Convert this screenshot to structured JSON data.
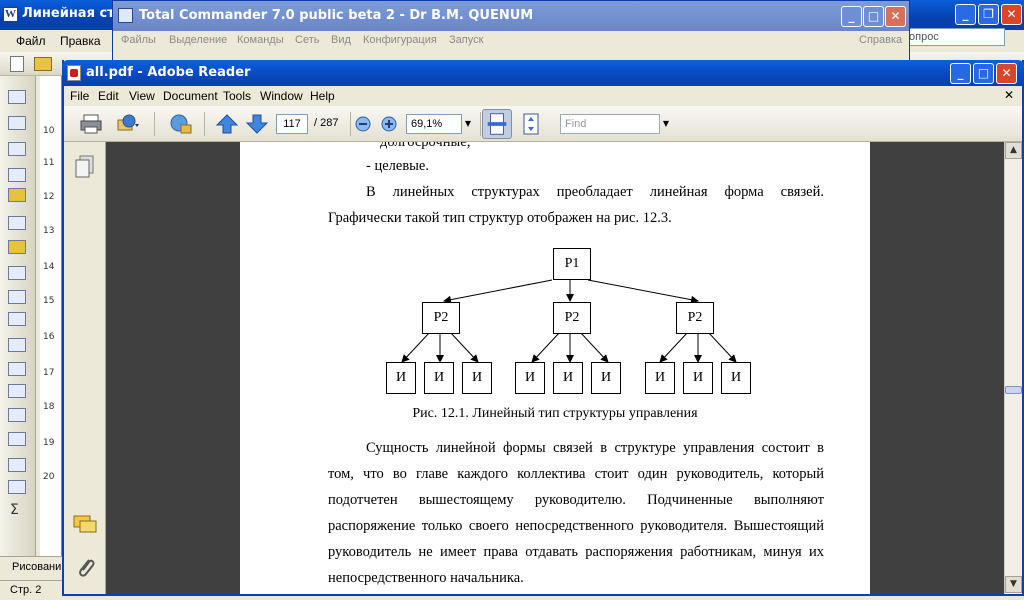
{
  "word": {
    "title": "Линейная стру",
    "menu": [
      "Файл",
      "Правка"
    ],
    "help_placeholder": "опрос",
    "draw_label": "Рисовани",
    "status": "Стр. 2",
    "ruler_numbers": [
      "10",
      "11",
      "12",
      "13",
      "14",
      "15",
      "16",
      "17",
      "18",
      "19",
      "20"
    ]
  },
  "tc": {
    "title": "Total Commander 7.0 public beta 2 - Dr B.M. QUENUM",
    "menu": [
      "Файлы",
      "Выделение",
      "Команды",
      "Сеть",
      "Вид",
      "Конфигурация",
      "Запуск"
    ],
    "help": "Справка"
  },
  "reader": {
    "title": "all.pdf - Adobe Reader",
    "menu": [
      "File",
      "Edit",
      "View",
      "Document",
      "Tools",
      "Window",
      "Help"
    ],
    "page_current": "117",
    "page_total": "/ 287",
    "zoom": "69,1%",
    "find_placeholder": "Find"
  },
  "document": {
    "top_fragment": "долгосрочные;",
    "bullet": "-  целевые.",
    "para1_line1": "В линейных структурах преобладает линейная форма связей.",
    "para1_line2": "Графически такой тип структур отображен на рис. 12.3.",
    "caption": "Рис. 12.1. Линейный тип структуры управления",
    "para2": [
      "Сущность линейной формы связей в структуре управления состоит в",
      "том, что во главе каждого коллектива стоит один руководитель, который",
      "подотчетен вышестоящему руководителю. Подчиненные выполняют",
      "распоряжение только своего непосредственного руководителя. Вышестоящий",
      "руководитель не имеет права отдавать распоряжения работникам, минуя их",
      "непосредственного начальника."
    ]
  },
  "diagram": {
    "root": "Р1",
    "managers": [
      "Р2",
      "Р2",
      "Р2"
    ],
    "workers": [
      "И",
      "И",
      "И",
      "И",
      "И",
      "И",
      "И",
      "И",
      "И"
    ]
  }
}
